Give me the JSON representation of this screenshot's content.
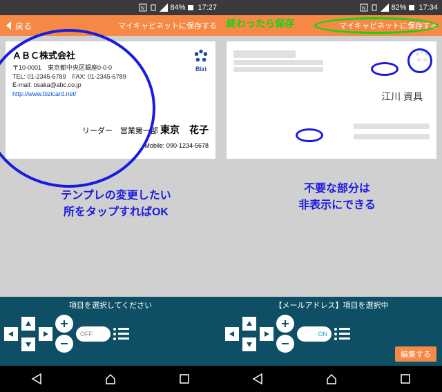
{
  "left": {
    "status": {
      "battery": "84%",
      "time": "17:27"
    },
    "header": {
      "back": "戻る",
      "save": "マイキャビネットに保存する"
    },
    "card": {
      "company": "ＡＢＣ株式会社",
      "addr1": "〒10-0001　東京都中央区銀座0-0-0",
      "addr2": "TEL: 01-2345-6789　FAX: 01-2345-6789",
      "email": "E-mail: osaka@abc.co.jp",
      "url": "http://www.bizicard.net/",
      "role": "リーダー　営業第一部",
      "name": "東京　花子",
      "mobile": "Mobile: 090-1234-5678",
      "logo": "Bizi"
    },
    "caption1": "テンプレの変更したい",
    "caption2": "所をタップすればOK",
    "panel": {
      "label": "項目を選択してください",
      "toggle": "OFF"
    }
  },
  "right": {
    "status": {
      "battery": "82%",
      "time": "17:34"
    },
    "header": {
      "save": "マイキャビネットに保存する",
      "done": "終わったら保存"
    },
    "card": {
      "name": "江川 資具"
    },
    "caption1": "不要な部分は",
    "caption2": "非表示にできる",
    "panel": {
      "label": "【メールアドレス】項目を選択中",
      "toggle": "ON",
      "edit": "編集する"
    }
  }
}
